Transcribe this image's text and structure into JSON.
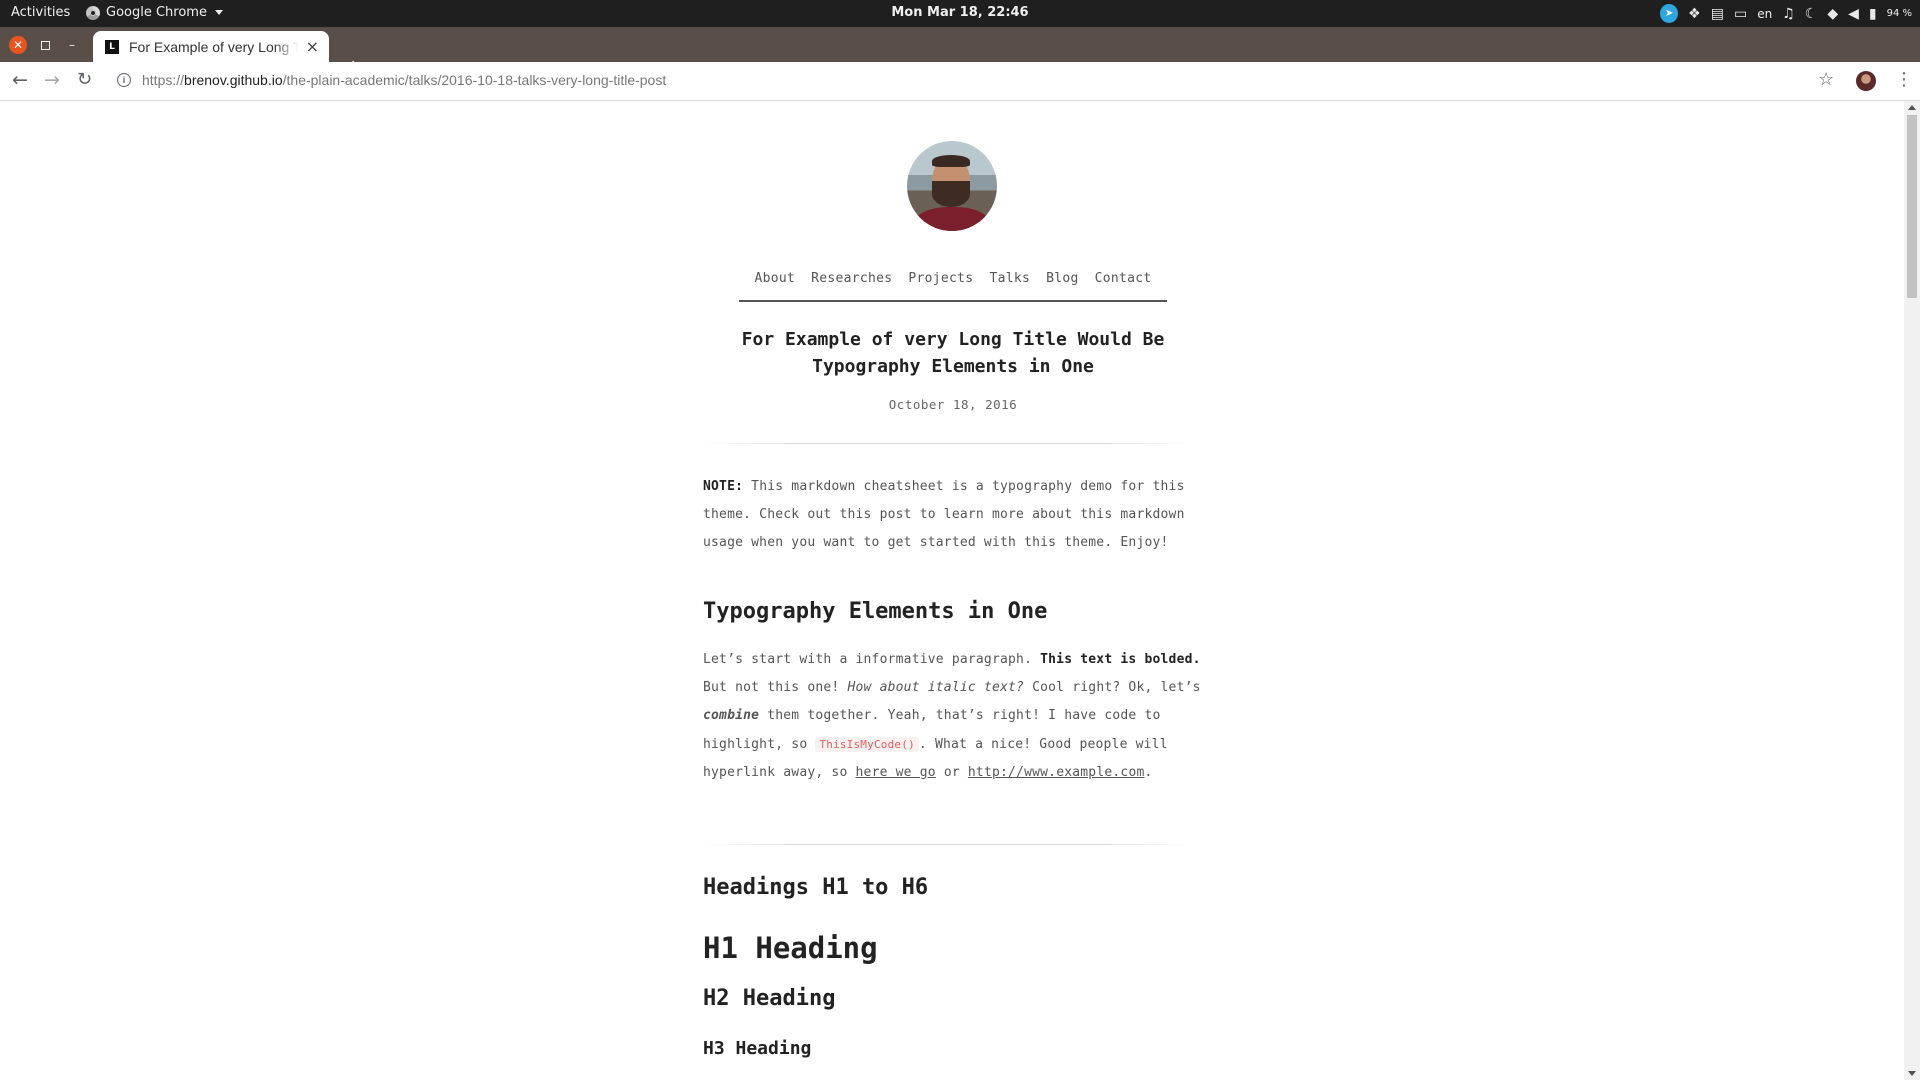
{
  "system": {
    "activities": "Activities",
    "app_name": "Google Chrome",
    "clock": "Mon Mar 18, 22:46",
    "lang": "en",
    "battery": "94 %"
  },
  "browser": {
    "tab_title": "For Example of very Long Title Would Be Typography Elements in One",
    "favicon_text": "L",
    "url_scheme": "https://",
    "url_host": "brenov.github.io",
    "url_path": "/the-plain-academic/talks/2016-10-18-talks-very-long-title-post"
  },
  "nav": {
    "items": [
      "About",
      "Researches",
      "Projects",
      "Talks",
      "Blog",
      "Contact"
    ]
  },
  "post": {
    "title_line1": "For Example of very Long Title Would Be",
    "title_line2": "Typography Elements in One",
    "date": "October 18, 2016"
  },
  "note": {
    "label": "NOTE:",
    "text": " This markdown cheatsheet is a typography demo for this theme. Check out this post to learn more about this markdown usage when you want to get started with this theme. Enjoy!"
  },
  "typography": {
    "heading": "Typography Elements in One",
    "t1": "Let’s start with a informative paragraph. ",
    "bold": "This text is bolded.",
    "t2": " But not this one! ",
    "italic": "How about italic text?",
    "t3": " Cool right? Ok, let’s ",
    "bold_italic": "combine",
    "t4": " them together. Yeah, that’s right! I have code to highlight, so ",
    "code": "ThisIsMyCode()",
    "t5": ". What a nice! Good people will hyperlink away, so ",
    "link1": "here we go",
    "t6": " or ",
    "link2": "http://www.example.com",
    "t7": "."
  },
  "headings": {
    "section": "Headings H1 to H6",
    "h1": "H1 Heading",
    "h2": "H2 Heading",
    "h3": "H3 Heading"
  }
}
